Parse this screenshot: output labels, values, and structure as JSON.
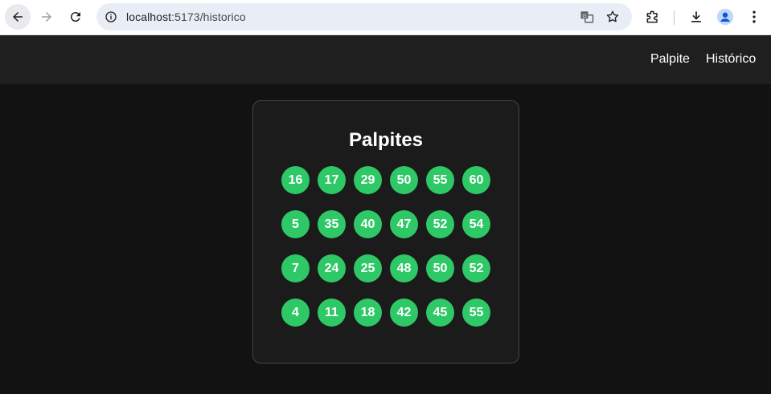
{
  "browser": {
    "url_host": "localhost",
    "url_path": ":5173/historico"
  },
  "header": {
    "nav": [
      {
        "label": "Palpite"
      },
      {
        "label": "Histórico"
      }
    ]
  },
  "card": {
    "title": "Palpites",
    "rows": [
      [
        "16",
        "17",
        "29",
        "50",
        "55",
        "60"
      ],
      [
        "5",
        "35",
        "40",
        "47",
        "52",
        "54"
      ],
      [
        "7",
        "24",
        "25",
        "48",
        "50",
        "52"
      ],
      [
        "4",
        "11",
        "18",
        "42",
        "45",
        "55"
      ]
    ]
  },
  "colors": {
    "ball": "#2ec866",
    "background": "#121212",
    "header": "#1f1f1f",
    "card": "#1b1b1b"
  }
}
